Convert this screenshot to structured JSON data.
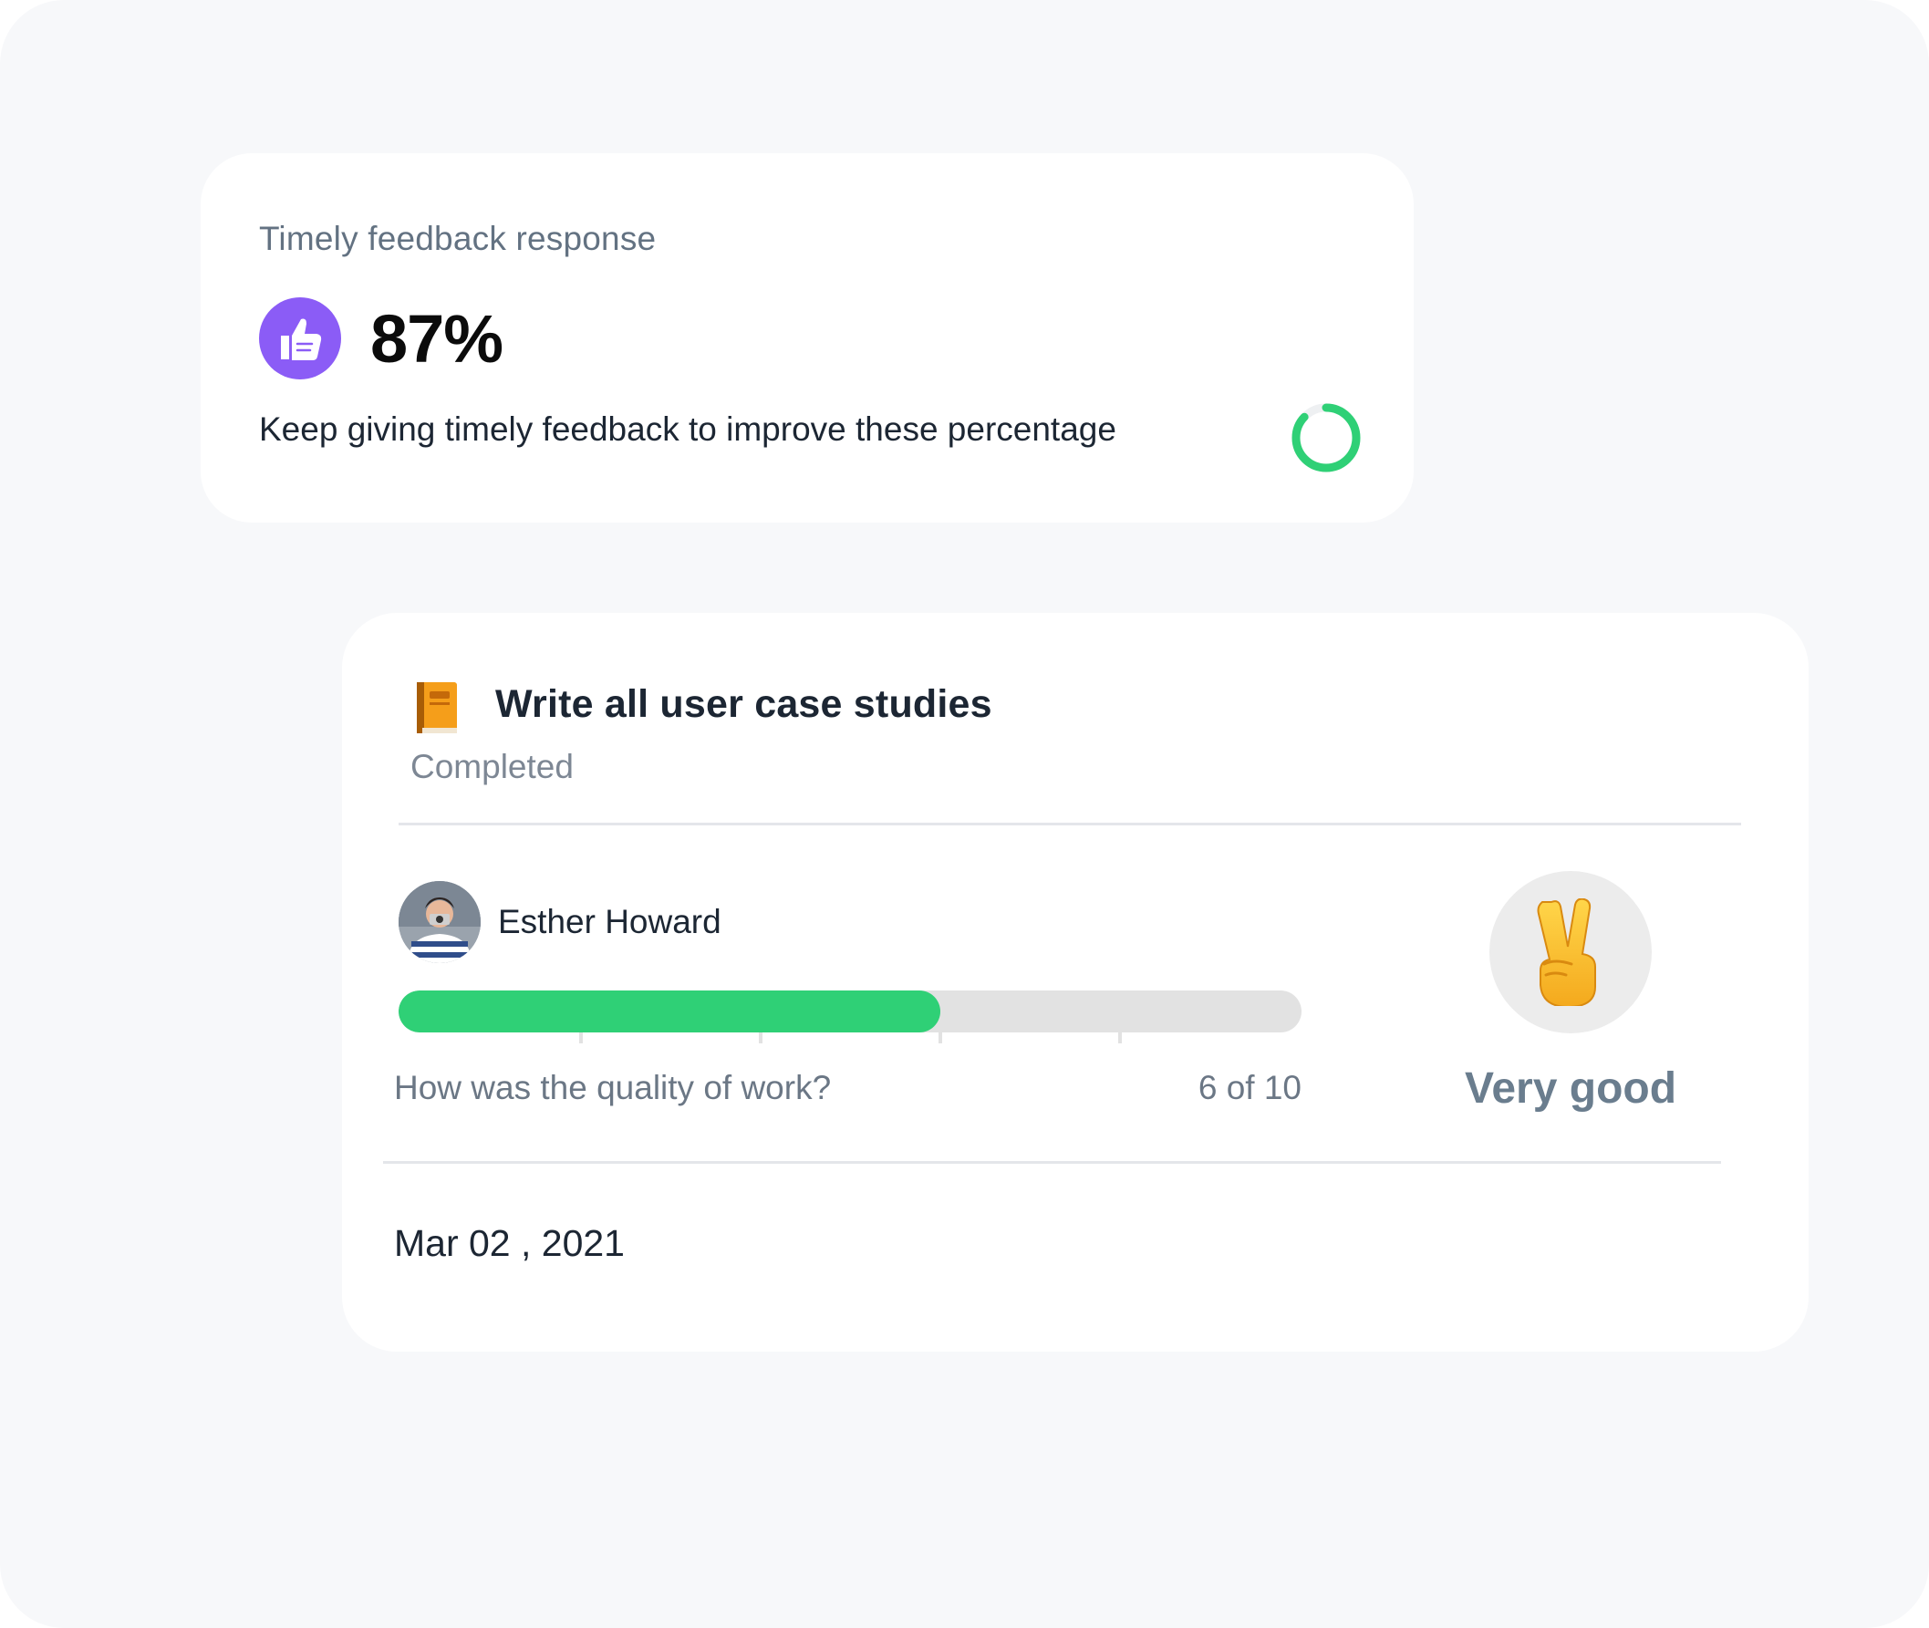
{
  "feedback_card": {
    "label": "Timely feedback response",
    "percent": "87%",
    "percent_value": 87,
    "hint": "Keep giving timely feedback to improve these percentage",
    "accent_color": "#8b5cf6",
    "ring_color": "#2fd076",
    "icon": "thumbs-up-icon"
  },
  "task_card": {
    "icon": "book-icon",
    "title": "Write all user case studies",
    "status": "Completed",
    "reviewer": {
      "name": "Esther Howard",
      "avatar": "avatar-photo"
    },
    "rating": {
      "question": "How was the quality of work?",
      "score_text": "6 of 10",
      "score": 6,
      "max": 10,
      "label": "Very good",
      "emoji": "victory-hand-icon",
      "bar_color": "#2fd076"
    },
    "date": "Mar 02 , 2021"
  }
}
